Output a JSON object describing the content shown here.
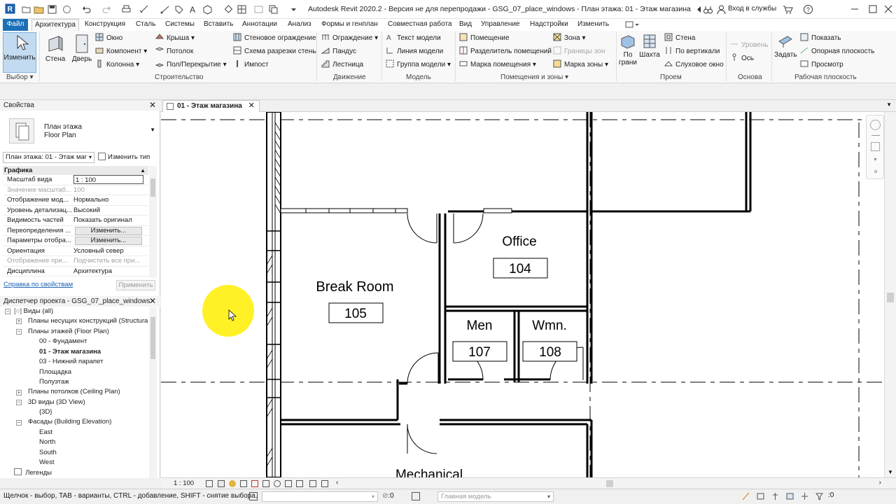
{
  "app": {
    "title": "Autodesk Revit 2020.2 - Версия не для перепродажи - GSG_07_place_windows - План этажа: 01 - Этаж магазина",
    "signin": "Вход в службы",
    "accent": "#1b70b7"
  },
  "ribbon_tabs": [
    "Файл",
    "Архитектура",
    "Конструкция",
    "Сталь",
    "Системы",
    "Вставить",
    "Аннотации",
    "Анализ",
    "Формы и генплан",
    "Совместная работа",
    "Вид",
    "Управление",
    "Надстройки",
    "Изменить"
  ],
  "ribbon": {
    "select": {
      "button": "Изменить",
      "group": "Выбор"
    },
    "build": {
      "group": "Строительство",
      "big": [
        "Стена",
        "Дверь"
      ],
      "col1": [
        "Окно",
        "Компонент",
        "Колонна"
      ],
      "col2": [
        "Крыша",
        "Потолок",
        "Пол/Перекрытие"
      ],
      "col3": [
        "Стеновое ограждение",
        "Схема разрезки стены",
        "Импост"
      ]
    },
    "circulation": {
      "group": "Движение",
      "items": [
        "Ограждение",
        "Пандус",
        "Лестница"
      ]
    },
    "model": {
      "group": "Модель",
      "items": [
        "Текст модели",
        "Линия модели",
        "Группа модели"
      ]
    },
    "rooms": {
      "group": "Помещения и зоны",
      "col1": [
        "Помещение",
        "Разделитель помещений",
        "Марка помещения"
      ],
      "col2": [
        "Зона",
        "Границы зон",
        "Марка зоны"
      ]
    },
    "opening": {
      "group": "Проем",
      "big": [
        "По грани",
        "Шахта"
      ],
      "items": [
        "Стена",
        "По вертикали",
        "Слуховое окно"
      ]
    },
    "datum": {
      "group": "Основа",
      "items": [
        "Уровень",
        "Ось"
      ]
    },
    "workplane": {
      "group": "Рабочая плоскость",
      "big": "Задать",
      "items": [
        "Показать",
        "Опорная плоскость",
        "Просмотр"
      ]
    }
  },
  "properties": {
    "title": "Свойства",
    "type_family": "План этажа",
    "type_name": "Floor Plan",
    "instance_selector": "План этажа: 01 - Этаж маг",
    "edit_type": "Изменить тип",
    "section": "Графика",
    "rows": [
      {
        "k": "Масштаб вида",
        "v": "1 : 100"
      },
      {
        "k": "Значение масштаб...",
        "v": "100"
      },
      {
        "k": "Отображение мод...",
        "v": "Нормально"
      },
      {
        "k": "Уровень детализац...",
        "v": "Высокий"
      },
      {
        "k": "Видимость частей",
        "v": "Показать оригинал"
      },
      {
        "k": "Переопределения ...",
        "v": "Изменить..."
      },
      {
        "k": "Параметры отобра...",
        "v": "Изменить..."
      },
      {
        "k": "Ориентация",
        "v": "Условный север"
      },
      {
        "k": "Отображение при...",
        "v": "Подчистить все при..."
      },
      {
        "k": "Дисциплина",
        "v": "Архитектура"
      }
    ],
    "help_link": "Справка по свойствам",
    "apply": "Применить"
  },
  "browser": {
    "title": "Диспетчер проекта - GSG_07_place_windows",
    "items": [
      "Виды (all)",
      "Планы несущих конструкций (Structura",
      "Планы этажей (Floor Plan)",
      "00 - Фундамент",
      "01 - Этаж магазина",
      "03 - Нижний парапет",
      "Площадка",
      "Полуэтаж",
      "Планы потолков (Ceiling Plan)",
      "3D виды (3D View)",
      "{3D}",
      "Фасады (Building Elevation)",
      "East",
      "North",
      "South",
      "West",
      "Легенды"
    ]
  },
  "view": {
    "tab": "01 - Этаж магазина",
    "scale": "1 : 100",
    "rooms": [
      {
        "name": "Office",
        "number": "104"
      },
      {
        "name": "Break Room",
        "number": "105"
      },
      {
        "name": "Men",
        "number": "107"
      },
      {
        "name": "Wmn.",
        "number": "108"
      },
      {
        "name": "Mechanical",
        "number": ""
      }
    ]
  },
  "status": {
    "hint": "Щелчок - выбор, TAB - варианты, CTRL - добавление, SHIFT - снятие выбора.",
    "count": ":0",
    "model": "Главная модель",
    "filter_count": ":0"
  }
}
